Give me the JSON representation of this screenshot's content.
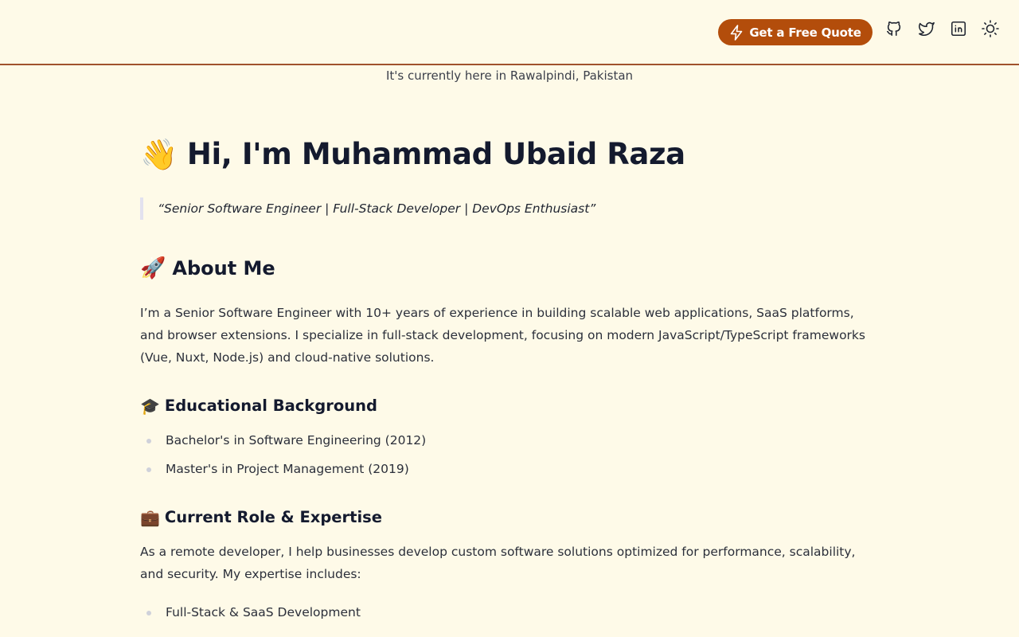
{
  "header": {
    "quote_button_label": "Get a Free Quote",
    "quote_button_icon": "bolt-icon",
    "accent_color": "#b34d0b",
    "divider_color": "#a0522d",
    "social_icons": [
      "github-icon",
      "twitter-icon",
      "linkedin-icon"
    ],
    "theme_toggle_icon": "sun-icon"
  },
  "location_text": "It's currently here in Rawalpindi, Pakistan",
  "hero": {
    "emoji": "👋",
    "title": "Hi, I'm Muhammad Ubaid Raza",
    "tagline": "“Senior Software Engineer | Full-Stack Developer | DevOps Enthusiast”"
  },
  "about": {
    "emoji": "🚀",
    "heading": "About Me",
    "body": "I’m a Senior Software Engineer with 10+ years of experience in building scalable web applications, SaaS platforms, and browser extensions. I specialize in full-stack development, focusing on modern JavaScript/TypeScript frameworks (Vue, Nuxt, Node.js) and cloud-native solutions."
  },
  "education": {
    "emoji": "🎓",
    "heading": "Educational Background",
    "items": [
      "Bachelor's in Software Engineering (2012)",
      "Master's in Project Management (2019)"
    ]
  },
  "role": {
    "emoji": "💼",
    "heading": "Current Role & Expertise",
    "body": "As a remote developer, I help businesses develop custom software solutions optimized for performance, scalability, and security. My expertise includes:",
    "items": [
      "Full-Stack & SaaS Development"
    ]
  },
  "colors": {
    "background": "#fefae8",
    "heading_text": "#141a2e",
    "body_text": "#2b2f3a"
  }
}
